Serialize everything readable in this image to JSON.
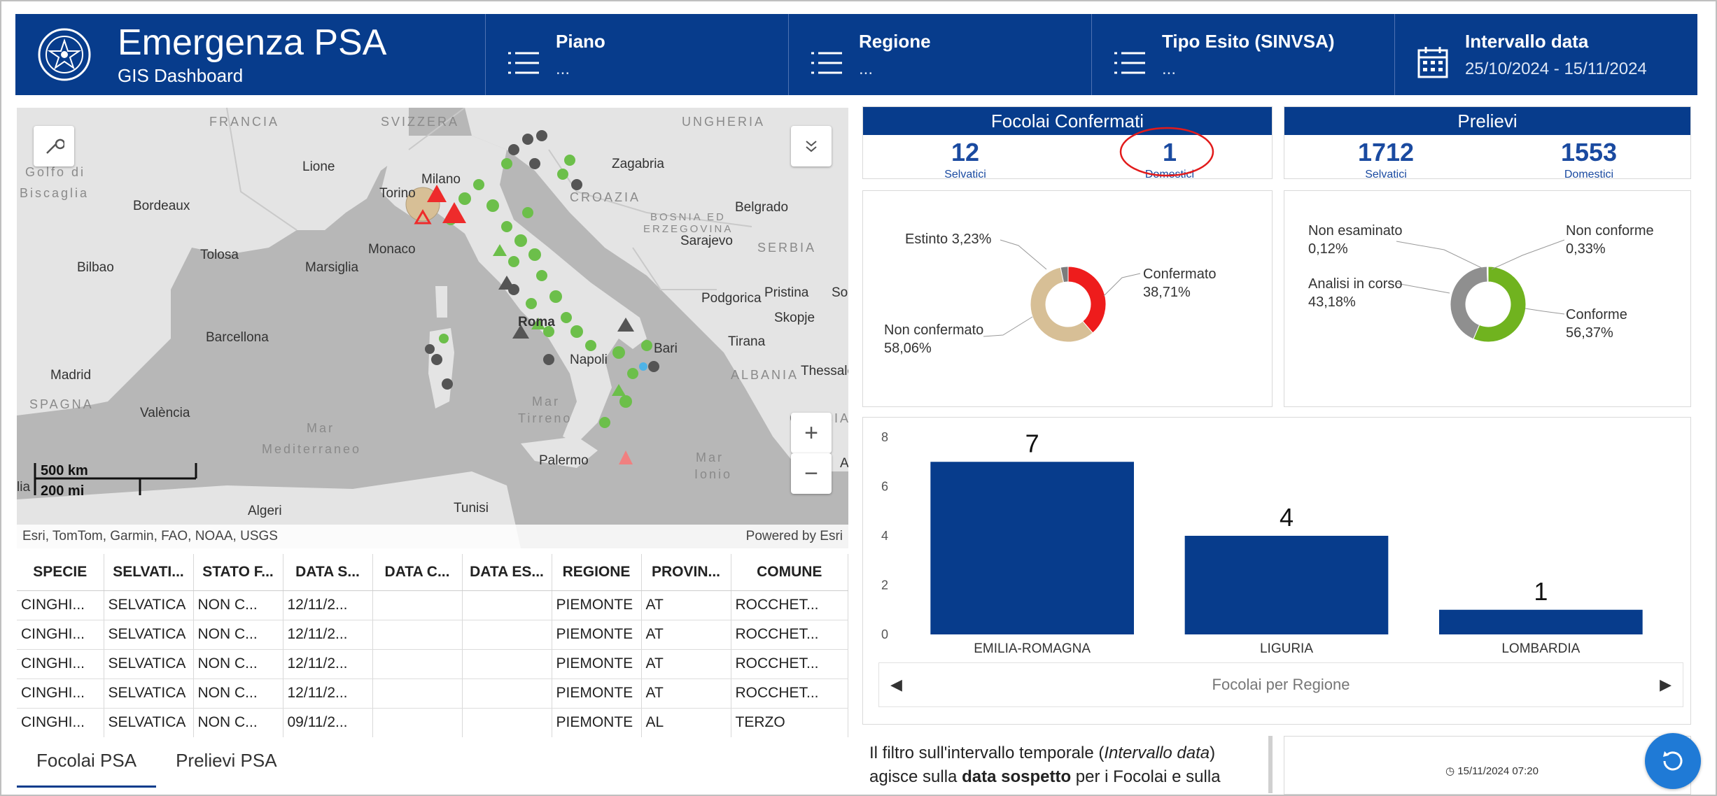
{
  "header": {
    "title": "Emergenza PSA",
    "subtitle": "GIS Dashboard",
    "filters": [
      {
        "title": "Piano",
        "value": "...",
        "icon": "list-icon"
      },
      {
        "title": "Regione",
        "value": "...",
        "icon": "list-icon"
      },
      {
        "title": "Tipo Esito (SINVSA)",
        "value": "...",
        "icon": "list-icon"
      },
      {
        "title": "Intervallo data",
        "value": "25/10/2024 - 15/11/2024",
        "icon": "calendar-icon"
      }
    ]
  },
  "map": {
    "labels": {
      "francia": "FRANCIA",
      "svizzera": "SVIZZERA",
      "ungheria": "UNGHERIA",
      "golfo": "Golfo di",
      "biscaglia": "Biscaglia",
      "lione": "Lione",
      "milano": "Milano",
      "torino": "Torino",
      "zagabria": "Zagabria",
      "croazia": "CROAZIA",
      "bordeaux": "Bordeaux",
      "belgrado": "Belgrado",
      "bosnia": "BOSNIA ED",
      "erzegovina": "ERZEGOVINA",
      "sarajevo": "Sarajevo",
      "serbia": "SERBIA",
      "bilbao": "Bilbao",
      "tolosa": "Tolosa",
      "marsiglia": "Marsiglia",
      "monaco": "Monaco",
      "podgorica": "Podgorica",
      "pristina": "Pristina",
      "so": "So",
      "skopje": "Skopje",
      "roma": "Roma",
      "bari": "Bari",
      "tirana": "Tirana",
      "barcellona": "Barcellona",
      "napoli": "Napoli",
      "albania": "ALBANIA",
      "thessal": "Thessalo",
      "madrid": "Madrid",
      "spagna": "SPAGNA",
      "valencia": "València",
      "mar1": "Mar",
      "tirreno": "Tirreno",
      "grecia": "GRECIA",
      "mar2": "Mar",
      "mediterraneo": "Mediterraneo",
      "palermo": "Palermo",
      "mar3": "Mar",
      "ionio": "Ionio",
      "algeri": "Algeri",
      "tunisi": "Tunisi",
      "lia": "lia",
      "a": "A"
    },
    "scale_km": "500 km",
    "scale_mi": "200 mi",
    "attribution": "Esri, TomTom, Garmin, FAO, NOAA, USGS",
    "powered": "Powered by Esri",
    "zoom_in": "+",
    "zoom_out": "−",
    "colors": {
      "water": "#b7b7b7",
      "land": "#e3e3e3",
      "wild": "#6cbf4a",
      "domestic": "#555555",
      "confirmed": "#ee2b2b"
    }
  },
  "table": {
    "columns": [
      "SPECIE",
      "SELVATI...",
      "STATO F...",
      "DATA S...",
      "DATA C...",
      "DATA ES...",
      "REGIONE",
      "PROVIN...",
      "COMUNE"
    ],
    "rows": [
      [
        "CINGHI...",
        "SELVATICA",
        "NON C...",
        "12/11/2...",
        "",
        "",
        "PIEMONTE",
        "AT",
        "ROCCHET..."
      ],
      [
        "CINGHI...",
        "SELVATICA",
        "NON C...",
        "12/11/2...",
        "",
        "",
        "PIEMONTE",
        "AT",
        "ROCCHET..."
      ],
      [
        "CINGHI...",
        "SELVATICA",
        "NON C...",
        "12/11/2...",
        "",
        "",
        "PIEMONTE",
        "AT",
        "ROCCHET..."
      ],
      [
        "CINGHI...",
        "SELVATICA",
        "NON C...",
        "12/11/2...",
        "",
        "",
        "PIEMONTE",
        "AT",
        "ROCCHET..."
      ],
      [
        "CINGHI...",
        "SELVATICA",
        "NON C...",
        "09/11/2...",
        "",
        "",
        "PIEMONTE",
        "AL",
        "TERZO"
      ]
    ]
  },
  "tabs": [
    "Focolai PSA",
    "Prelievi PSA"
  ],
  "focolai": {
    "title": "Focolai Confermati",
    "wild_value": "12",
    "wild_label": "Selvatici",
    "dom_value": "1",
    "dom_label": "Domestici"
  },
  "prelievi": {
    "title": "Prelievi",
    "wild_value": "1712",
    "wild_label": "Selvatici",
    "dom_value": "1553",
    "dom_label": "Domestici"
  },
  "chart_data": [
    {
      "type": "pie",
      "labels": [
        "Confermato",
        "Non confermato",
        "Estinto"
      ],
      "values": [
        38.71,
        58.06,
        3.23
      ],
      "display": [
        "Confermato\n38,71%",
        "Non confermato\n58,06%",
        "Estinto 3,23%"
      ],
      "colors": [
        "#ee1c1c",
        "#d7bf96",
        "#7c7c7c"
      ]
    },
    {
      "type": "pie",
      "labels": [
        "Conforme",
        "Analisi in corso",
        "Non conforme",
        "Non esaminato"
      ],
      "values": [
        56.37,
        43.18,
        0.33,
        0.12
      ],
      "display": [
        "Conforme\n56,37%",
        "Analisi in corso\n43,18%",
        "Non conforme\n0,33%",
        "Non esaminato\n0,12%"
      ],
      "colors": [
        "#70b31f",
        "#8f8f8f",
        "#3a6fbf",
        "#cccccc"
      ]
    },
    {
      "type": "bar",
      "title": "Focolai per Regione",
      "categories": [
        "EMILIA-ROMAGNA",
        "LIGURIA",
        "LOMBARDIA"
      ],
      "values": [
        7,
        4,
        1
      ],
      "yticks": [
        0,
        2,
        4,
        6,
        8
      ],
      "ylim": [
        0,
        8
      ],
      "color": "#073c8c"
    }
  ],
  "note": {
    "prefix": "Il filtro sull'intervallo temporale (",
    "italic": "Intervallo data",
    "suffix": ") agisce sulla ",
    "bold": "data sospetto",
    "tail": " per i Focolai e sulla"
  },
  "timestamp": "15/11/2024 07:20"
}
